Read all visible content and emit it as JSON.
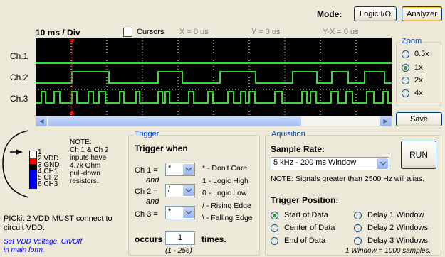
{
  "mode": {
    "label": "Mode:",
    "logic_io": "Logic I/O",
    "analyzer": "Analyzer"
  },
  "scope": {
    "timebase": "10 ms / Div",
    "cursors_label": "Cursors",
    "x_readout": "X = 0 us",
    "y_readout": "Y = 0 us",
    "yx_readout": "Y-X = 0 us",
    "channels": [
      "Ch.1",
      "Ch.2",
      "Ch.3"
    ],
    "trace_color": "#39d839",
    "background": "#000000",
    "cursor_color": "#ff0000"
  },
  "zoom": {
    "title": "Zoom",
    "options": [
      "0.5x",
      "1x",
      "2x",
      "4x"
    ],
    "selected": "1x"
  },
  "save_label": "Save",
  "pinout": {
    "pins": [
      {
        "num": "1",
        "name": "",
        "color": "#ffffff"
      },
      {
        "num": "2",
        "name": "VDD",
        "color": "#ff0000"
      },
      {
        "num": "3",
        "name": "GND",
        "color": "#000000"
      },
      {
        "num": "4",
        "name": "CH1",
        "color": "#0000ff"
      },
      {
        "num": "5",
        "name": "CH2",
        "color": "#0000ff"
      },
      {
        "num": "6",
        "name": "CH3",
        "color": "#0000ff"
      }
    ],
    "note_lines": [
      "NOTE:",
      "Ch 1 & Ch 2",
      "inputs have",
      "4.7k Ohm",
      "pull-down",
      "resistors."
    ],
    "warning_line1": "PICkit 2 VDD MUST connect to",
    "warning_line2": "circuit VDD.",
    "link_line1": "Set VDD Voltage, On/Off",
    "link_line2": "in main form."
  },
  "trigger": {
    "title": "Trigger",
    "heading": "Trigger when",
    "ch1_label": "Ch 1 =",
    "ch2_label": "Ch 2 =",
    "ch3_label": "Ch 3 =",
    "and": "and",
    "ch1_value": "*",
    "ch2_value": "/",
    "ch3_value": "*",
    "legend": [
      "* - Don't Care",
      "1 - Logic High",
      "0 - Logic Low",
      "/ - Rising Edge",
      "\\ - Falling Edge"
    ],
    "occurs_label": "occurs",
    "occurs_value": "1",
    "times_label": "times.",
    "range_hint": "(1 - 256)"
  },
  "acquisition": {
    "title": "Aquisition",
    "sample_rate_label": "Sample Rate:",
    "sample_rate_value": "5 kHz - 200 ms Window",
    "run_label": "RUN",
    "alias_note": "NOTE: Signals greater than 2500 Hz will alias.",
    "trigger_position_label": "Trigger Position:",
    "positions": [
      "Start of Data",
      "Center of Data",
      "End of Data",
      "Delay 1 Window",
      "Delay 2 Windows",
      "Delay 3 Windows"
    ],
    "selected_position": "Start of Data",
    "window_note": "1 Window = 1000 samples."
  }
}
